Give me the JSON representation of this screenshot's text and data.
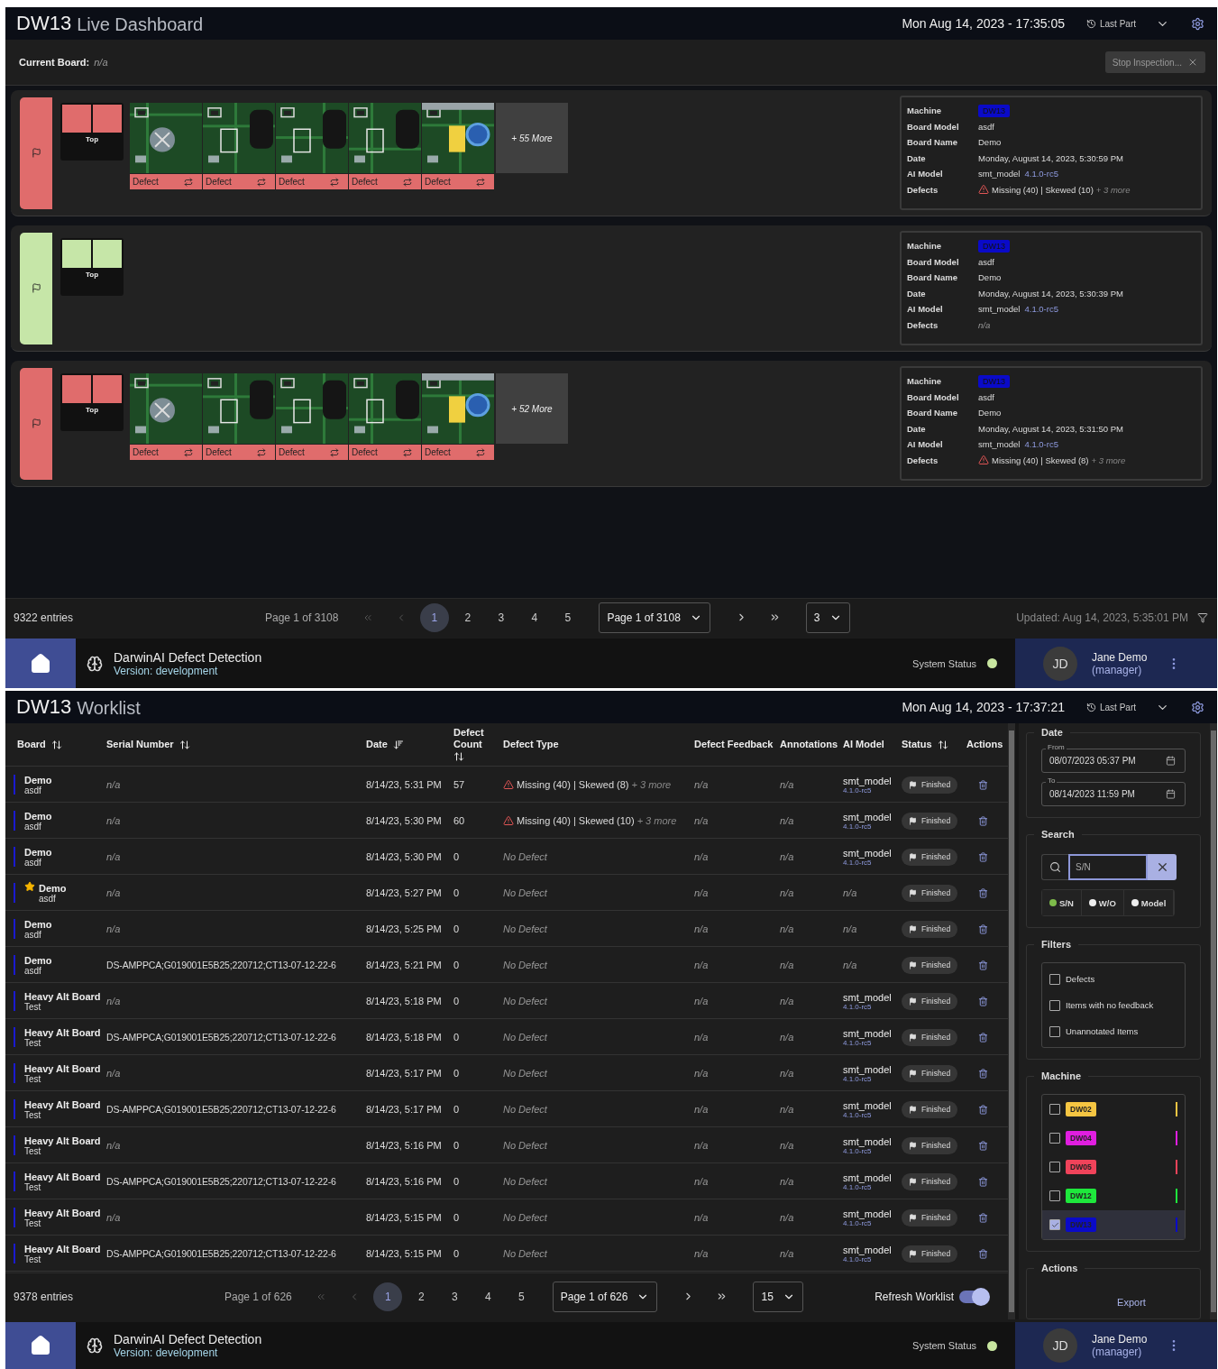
{
  "dashboard": {
    "header": {
      "machine": "DW13",
      "title": "Live Dashboard",
      "datetime": "Mon Aug 14, 2023 - 17:35:05",
      "last_part": "Last Part"
    },
    "current_board": {
      "label": "Current Board:",
      "value": "n/a"
    },
    "stop_button": "Stop Inspection...",
    "cards": [
      {
        "defective": true,
        "side_label": "Top",
        "defects": [
          "Defect",
          "Defect",
          "Defect",
          "Defect",
          "Defect"
        ],
        "more": "+ 55 More",
        "info": [
          {
            "label": "Machine",
            "kind": "badge",
            "value": "DW13",
            "color": "#0a0ac8"
          },
          {
            "label": "Board Model",
            "kind": "text",
            "value": "asdf"
          },
          {
            "label": "Board Name",
            "kind": "text",
            "value": "Demo"
          },
          {
            "label": "Date",
            "kind": "text",
            "value": "Monday, August 14, 2023, 5:30:59 PM"
          },
          {
            "label": "AI Model",
            "kind": "model",
            "value": "smt_model",
            "version": "4.1.0-rc5"
          },
          {
            "label": "Defects",
            "kind": "defects",
            "value": "Missing (40) | Skewed (10)",
            "more": "+ 3 more"
          }
        ]
      },
      {
        "defective": false,
        "side_label": "Top",
        "info": [
          {
            "label": "Machine",
            "kind": "badge",
            "value": "DW13",
            "color": "#0a0ac8"
          },
          {
            "label": "Board Model",
            "kind": "text",
            "value": "asdf"
          },
          {
            "label": "Board Name",
            "kind": "text",
            "value": "Demo"
          },
          {
            "label": "Date",
            "kind": "text",
            "value": "Monday, August 14, 2023, 5:30:39 PM"
          },
          {
            "label": "AI Model",
            "kind": "model",
            "value": "smt_model",
            "version": "4.1.0-rc5"
          },
          {
            "label": "Defects",
            "kind": "none",
            "value": "n/a"
          }
        ]
      },
      {
        "defective": true,
        "side_label": "Top",
        "defects": [
          "Defect",
          "Defect",
          "Defect",
          "Defect",
          "Defect"
        ],
        "more": "+ 52 More",
        "info": [
          {
            "label": "Machine",
            "kind": "badge",
            "value": "DW13",
            "color": "#0a0ac8"
          },
          {
            "label": "Board Model",
            "kind": "text",
            "value": "asdf"
          },
          {
            "label": "Board Name",
            "kind": "text",
            "value": "Demo"
          },
          {
            "label": "Date",
            "kind": "text",
            "value": "Monday, August 14, 2023, 5:31:50 PM"
          },
          {
            "label": "AI Model",
            "kind": "model",
            "value": "smt_model",
            "version": "4.1.0-rc5"
          },
          {
            "label": "Defects",
            "kind": "defects",
            "value": "Missing (40) | Skewed (8)",
            "more": "+ 3 more"
          }
        ]
      }
    ],
    "pagination": {
      "entries": "9322 entries",
      "page_label": "Page 1 of 3108",
      "pages": [
        {
          "label": "1",
          "selected": true
        },
        {
          "label": "2",
          "selected": false
        },
        {
          "label": "3",
          "selected": false
        },
        {
          "label": "4",
          "selected": false
        },
        {
          "label": "5",
          "selected": false
        }
      ],
      "page_select": "Page 1 of 3108",
      "page_size": "3",
      "updated": "Updated: Aug 14, 2023, 5:35:01 PM"
    },
    "footer": {
      "app_name": "DarwinAI Defect Detection",
      "version": "Version: development",
      "system_status": "System Status",
      "status_ok": true,
      "user": {
        "initials": "JD",
        "name": "Jane Demo",
        "role": "(manager)"
      }
    }
  },
  "worklist": {
    "header": {
      "machine": "DW13",
      "title": "Worklist",
      "datetime": "Mon Aug 14, 2023 - 17:37:21",
      "last_part": "Last Part"
    },
    "columns": [
      {
        "label": "Board",
        "sortable": true,
        "sorted": false
      },
      {
        "label": "Serial Number",
        "sortable": true,
        "sorted": false
      },
      {
        "label": "Date",
        "sortable": true,
        "sorted": true
      },
      {
        "label": "Defect Count",
        "sortable": true,
        "sorted": false
      },
      {
        "label": "Defect Type"
      },
      {
        "label": "Defect Feedback"
      },
      {
        "label": "Annotations"
      },
      {
        "label": "AI Model"
      },
      {
        "label": "Status",
        "sortable": true,
        "sorted": false
      },
      {
        "label": "Actions"
      }
    ],
    "rows": [
      {
        "color": "#1a1ad0",
        "starred": false,
        "board": "Demo",
        "model": "asdf",
        "serial": "n/a",
        "serial_known": false,
        "date": "8/14/23, 5:31 PM",
        "count": "57",
        "defect_type": {
          "kind": "defects",
          "value": "Missing (40) | Skewed (8)",
          "more": "+ 3 more"
        },
        "feedback": "n/a",
        "annotations": "n/a",
        "ai_model": {
          "kind": "model",
          "value": "smt_model",
          "version": "4.1.0-rc5"
        },
        "status": "Finished"
      },
      {
        "color": "#1a1ad0",
        "starred": false,
        "board": "Demo",
        "model": "asdf",
        "serial": "n/a",
        "serial_known": false,
        "date": "8/14/23, 5:30 PM",
        "count": "60",
        "defect_type": {
          "kind": "defects",
          "value": "Missing (40) | Skewed (10)",
          "more": "+ 3 more"
        },
        "feedback": "n/a",
        "annotations": "n/a",
        "ai_model": {
          "kind": "model",
          "value": "smt_model",
          "version": "4.1.0-rc5"
        },
        "status": "Finished"
      },
      {
        "color": "#1a1ad0",
        "starred": false,
        "board": "Demo",
        "model": "asdf",
        "serial": "n/a",
        "serial_known": false,
        "date": "8/14/23, 5:30 PM",
        "count": "0",
        "defect_type": {
          "kind": "none",
          "value": "No Defect"
        },
        "feedback": "n/a",
        "annotations": "n/a",
        "ai_model": {
          "kind": "model",
          "value": "smt_model",
          "version": "4.1.0-rc5"
        },
        "status": "Finished"
      },
      {
        "color": "#1a1ad0",
        "starred": true,
        "board": "Demo",
        "model": "asdf",
        "serial": "n/a",
        "serial_known": false,
        "date": "8/14/23, 5:27 PM",
        "count": "0",
        "defect_type": {
          "kind": "none",
          "value": "No Defect"
        },
        "feedback": "n/a",
        "annotations": "n/a",
        "ai_model": {
          "kind": "none",
          "value": "n/a"
        },
        "status": "Finished"
      },
      {
        "color": "#1a1ad0",
        "starred": false,
        "board": "Demo",
        "model": "asdf",
        "serial": "n/a",
        "serial_known": false,
        "date": "8/14/23, 5:25 PM",
        "count": "0",
        "defect_type": {
          "kind": "none",
          "value": "No Defect"
        },
        "feedback": "n/a",
        "annotations": "n/a",
        "ai_model": {
          "kind": "none",
          "value": "n/a"
        },
        "status": "Finished"
      },
      {
        "color": "#1a1ad0",
        "starred": false,
        "board": "Demo",
        "model": "asdf",
        "serial": "DS-AMPPCA;G019001E5B25;220712;CT13-07-12-22-6",
        "serial_known": true,
        "date": "8/14/23, 5:21 PM",
        "count": "0",
        "defect_type": {
          "kind": "none",
          "value": "No Defect"
        },
        "feedback": "n/a",
        "annotations": "n/a",
        "ai_model": {
          "kind": "none",
          "value": "n/a"
        },
        "status": "Finished"
      },
      {
        "color": "#1a1ad0",
        "starred": false,
        "board": "Heavy Alt Board",
        "model": "Test",
        "serial": "n/a",
        "serial_known": false,
        "date": "8/14/23, 5:18 PM",
        "count": "0",
        "defect_type": {
          "kind": "none",
          "value": "No Defect"
        },
        "feedback": "n/a",
        "annotations": "n/a",
        "ai_model": {
          "kind": "model",
          "value": "smt_model",
          "version": "4.1.0-rc5"
        },
        "status": "Finished"
      },
      {
        "color": "#1a1ad0",
        "starred": false,
        "board": "Heavy Alt Board",
        "model": "Test",
        "serial": "DS-AMPPCA;G019001E5B25;220712;CT13-07-12-22-6",
        "serial_known": true,
        "date": "8/14/23, 5:18 PM",
        "count": "0",
        "defect_type": {
          "kind": "none",
          "value": "No Defect"
        },
        "feedback": "n/a",
        "annotations": "n/a",
        "ai_model": {
          "kind": "model",
          "value": "smt_model",
          "version": "4.1.0-rc5"
        },
        "status": "Finished"
      },
      {
        "color": "#1a1ad0",
        "starred": false,
        "board": "Heavy Alt Board",
        "model": "Test",
        "serial": "n/a",
        "serial_known": false,
        "date": "8/14/23, 5:17 PM",
        "count": "0",
        "defect_type": {
          "kind": "none",
          "value": "No Defect"
        },
        "feedback": "n/a",
        "annotations": "n/a",
        "ai_model": {
          "kind": "model",
          "value": "smt_model",
          "version": "4.1.0-rc5"
        },
        "status": "Finished"
      },
      {
        "color": "#1a1ad0",
        "starred": false,
        "board": "Heavy Alt Board",
        "model": "Test",
        "serial": "DS-AMPPCA;G019001E5B25;220712;CT13-07-12-22-6",
        "serial_known": true,
        "date": "8/14/23, 5:17 PM",
        "count": "0",
        "defect_type": {
          "kind": "none",
          "value": "No Defect"
        },
        "feedback": "n/a",
        "annotations": "n/a",
        "ai_model": {
          "kind": "model",
          "value": "smt_model",
          "version": "4.1.0-rc5"
        },
        "status": "Finished"
      },
      {
        "color": "#1a1ad0",
        "starred": false,
        "board": "Heavy Alt Board",
        "model": "Test",
        "serial": "n/a",
        "serial_known": false,
        "date": "8/14/23, 5:16 PM",
        "count": "0",
        "defect_type": {
          "kind": "none",
          "value": "No Defect"
        },
        "feedback": "n/a",
        "annotations": "n/a",
        "ai_model": {
          "kind": "model",
          "value": "smt_model",
          "version": "4.1.0-rc5"
        },
        "status": "Finished"
      },
      {
        "color": "#1a1ad0",
        "starred": false,
        "board": "Heavy Alt Board",
        "model": "Test",
        "serial": "DS-AMPPCA;G019001E5B25;220712;CT13-07-12-22-6",
        "serial_known": true,
        "date": "8/14/23, 5:16 PM",
        "count": "0",
        "defect_type": {
          "kind": "none",
          "value": "No Defect"
        },
        "feedback": "n/a",
        "annotations": "n/a",
        "ai_model": {
          "kind": "model",
          "value": "smt_model",
          "version": "4.1.0-rc5"
        },
        "status": "Finished"
      },
      {
        "color": "#1a1ad0",
        "starred": false,
        "board": "Heavy Alt Board",
        "model": "Test",
        "serial": "n/a",
        "serial_known": false,
        "date": "8/14/23, 5:15 PM",
        "count": "0",
        "defect_type": {
          "kind": "none",
          "value": "No Defect"
        },
        "feedback": "n/a",
        "annotations": "n/a",
        "ai_model": {
          "kind": "model",
          "value": "smt_model",
          "version": "4.1.0-rc5"
        },
        "status": "Finished"
      },
      {
        "color": "#1a1ad0",
        "starred": false,
        "board": "Heavy Alt Board",
        "model": "Test",
        "serial": "DS-AMPPCA;G019001E5B25;220712;CT13-07-12-22-6",
        "serial_known": true,
        "date": "8/14/23, 5:15 PM",
        "count": "0",
        "defect_type": {
          "kind": "none",
          "value": "No Defect"
        },
        "feedback": "n/a",
        "annotations": "n/a",
        "ai_model": {
          "kind": "model",
          "value": "smt_model",
          "version": "4.1.0-rc5"
        },
        "status": "Finished"
      }
    ],
    "pagination": {
      "entries": "9378 entries",
      "page_label": "Page 1 of 626",
      "pages": [
        {
          "label": "1",
          "selected": true
        },
        {
          "label": "2",
          "selected": false
        },
        {
          "label": "3",
          "selected": false
        },
        {
          "label": "4",
          "selected": false
        },
        {
          "label": "5",
          "selected": false
        }
      ],
      "page_select": "Page 1 of 626",
      "page_size": "15",
      "refresh": {
        "label": "Refresh Worklist",
        "on": true
      }
    },
    "sidebar": {
      "date": {
        "title": "Date",
        "from": {
          "label": "From",
          "value": "08/07/2023 05:37 PM"
        },
        "to": {
          "label": "To",
          "value": "08/14/2023 11:59 PM"
        }
      },
      "search": {
        "title": "Search",
        "placeholder": "S/N",
        "modes": [
          {
            "label": "S/N",
            "selected": true
          },
          {
            "label": "W/O",
            "selected": false
          },
          {
            "label": "Model",
            "selected": false
          }
        ]
      },
      "filters": {
        "title": "Filters",
        "items": [
          {
            "label": "Defects",
            "checked": false
          },
          {
            "label": "Items with no feedback",
            "checked": false
          },
          {
            "label": "Unannotated Items",
            "checked": false
          }
        ]
      },
      "machines": {
        "title": "Machine",
        "items": [
          {
            "label": "DW02",
            "color": "#f5c542",
            "checked": false
          },
          {
            "label": "DW04",
            "color": "#e01ee0",
            "checked": false
          },
          {
            "label": "DW05",
            "color": "#f0435a",
            "checked": false
          },
          {
            "label": "DW12",
            "color": "#1ee83c",
            "checked": false
          },
          {
            "label": "DW13",
            "color": "#0a0ac8",
            "checked": true
          }
        ]
      },
      "actions": {
        "title": "Actions",
        "items": [
          "Export"
        ]
      }
    },
    "footer": {
      "app_name": "DarwinAI Defect Detection",
      "version": "Version: development",
      "system_status": "System Status",
      "status_ok": true,
      "user": {
        "initials": "JD",
        "name": "Jane Demo",
        "role": "(manager)"
      }
    }
  }
}
